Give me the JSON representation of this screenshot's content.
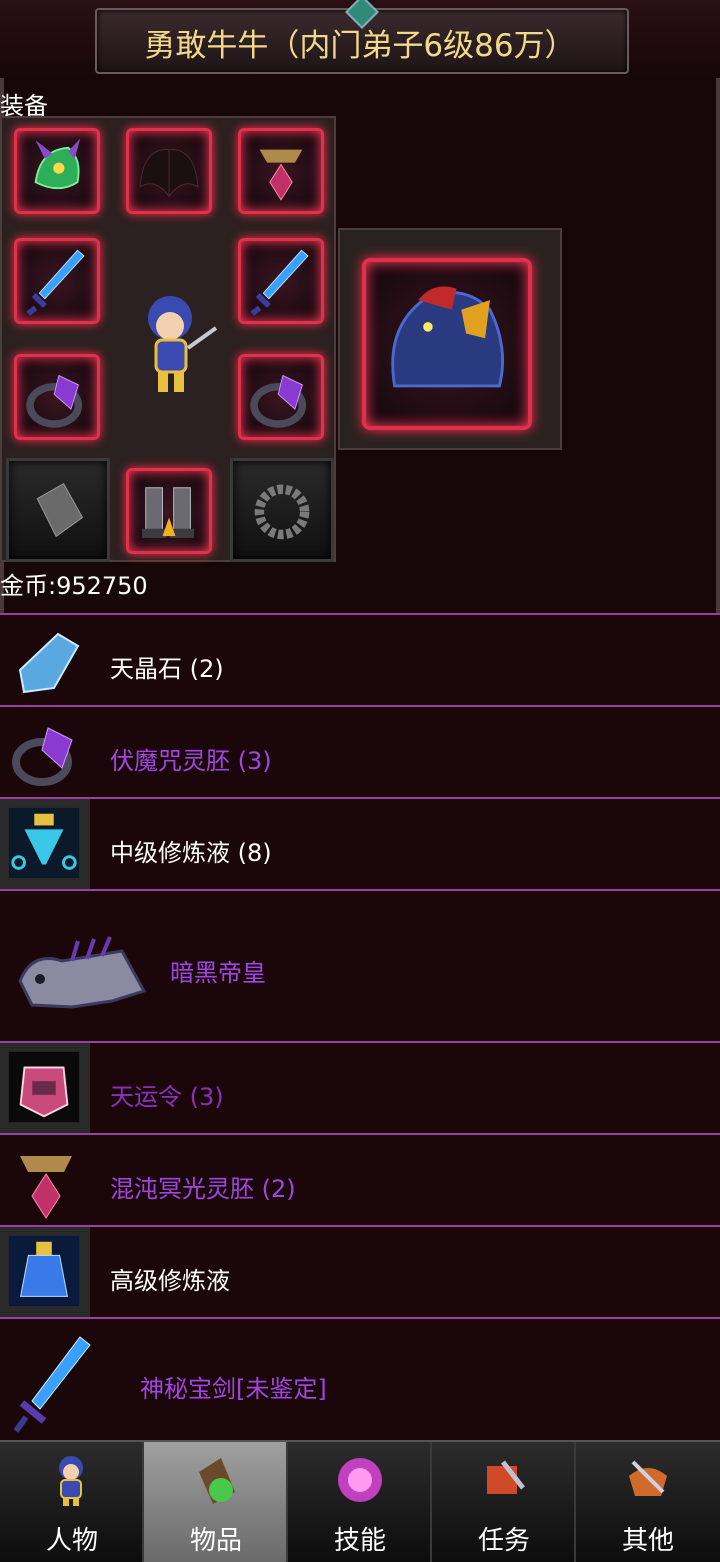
{
  "header": {
    "title": "勇敢牛牛（内门弟子6级86万）"
  },
  "equipment": {
    "label": "装备"
  },
  "gold": {
    "label": "金币:952750"
  },
  "items": [
    {
      "name": "天晶石 (2)",
      "color": "#ffffff",
      "icon": "crystal-icon"
    },
    {
      "name": "伏魔咒灵胚 (3)",
      "color": "#a046e0",
      "icon": "purple-ring-icon"
    },
    {
      "name": "中级修炼液 (8)",
      "color": "#ffffff",
      "icon": "potion-icon"
    },
    {
      "name": "暗黑帝皇",
      "color": "#a046e0",
      "icon": "bone-dragon-icon"
    },
    {
      "name": "天运令 (3)",
      "color": "#8b2fbe",
      "icon": "token-icon"
    },
    {
      "name": "混沌冥光灵胚 (2)",
      "color": "#a046e0",
      "icon": "amulet-icon"
    },
    {
      "name": "高级修炼液",
      "color": "#ffffff",
      "icon": "flask-icon"
    },
    {
      "name": "神秘宝剑[未鉴定]",
      "color": "#a046e0",
      "icon": "sword-icon"
    }
  ],
  "nav": {
    "tabs": [
      {
        "label": "人物",
        "icon": "character-icon"
      },
      {
        "label": "物品",
        "icon": "bag-icon",
        "active": true
      },
      {
        "label": "技能",
        "icon": "skill-orb-icon"
      },
      {
        "label": "任务",
        "icon": "quest-icon"
      },
      {
        "label": "其他",
        "icon": "other-icon"
      }
    ]
  }
}
